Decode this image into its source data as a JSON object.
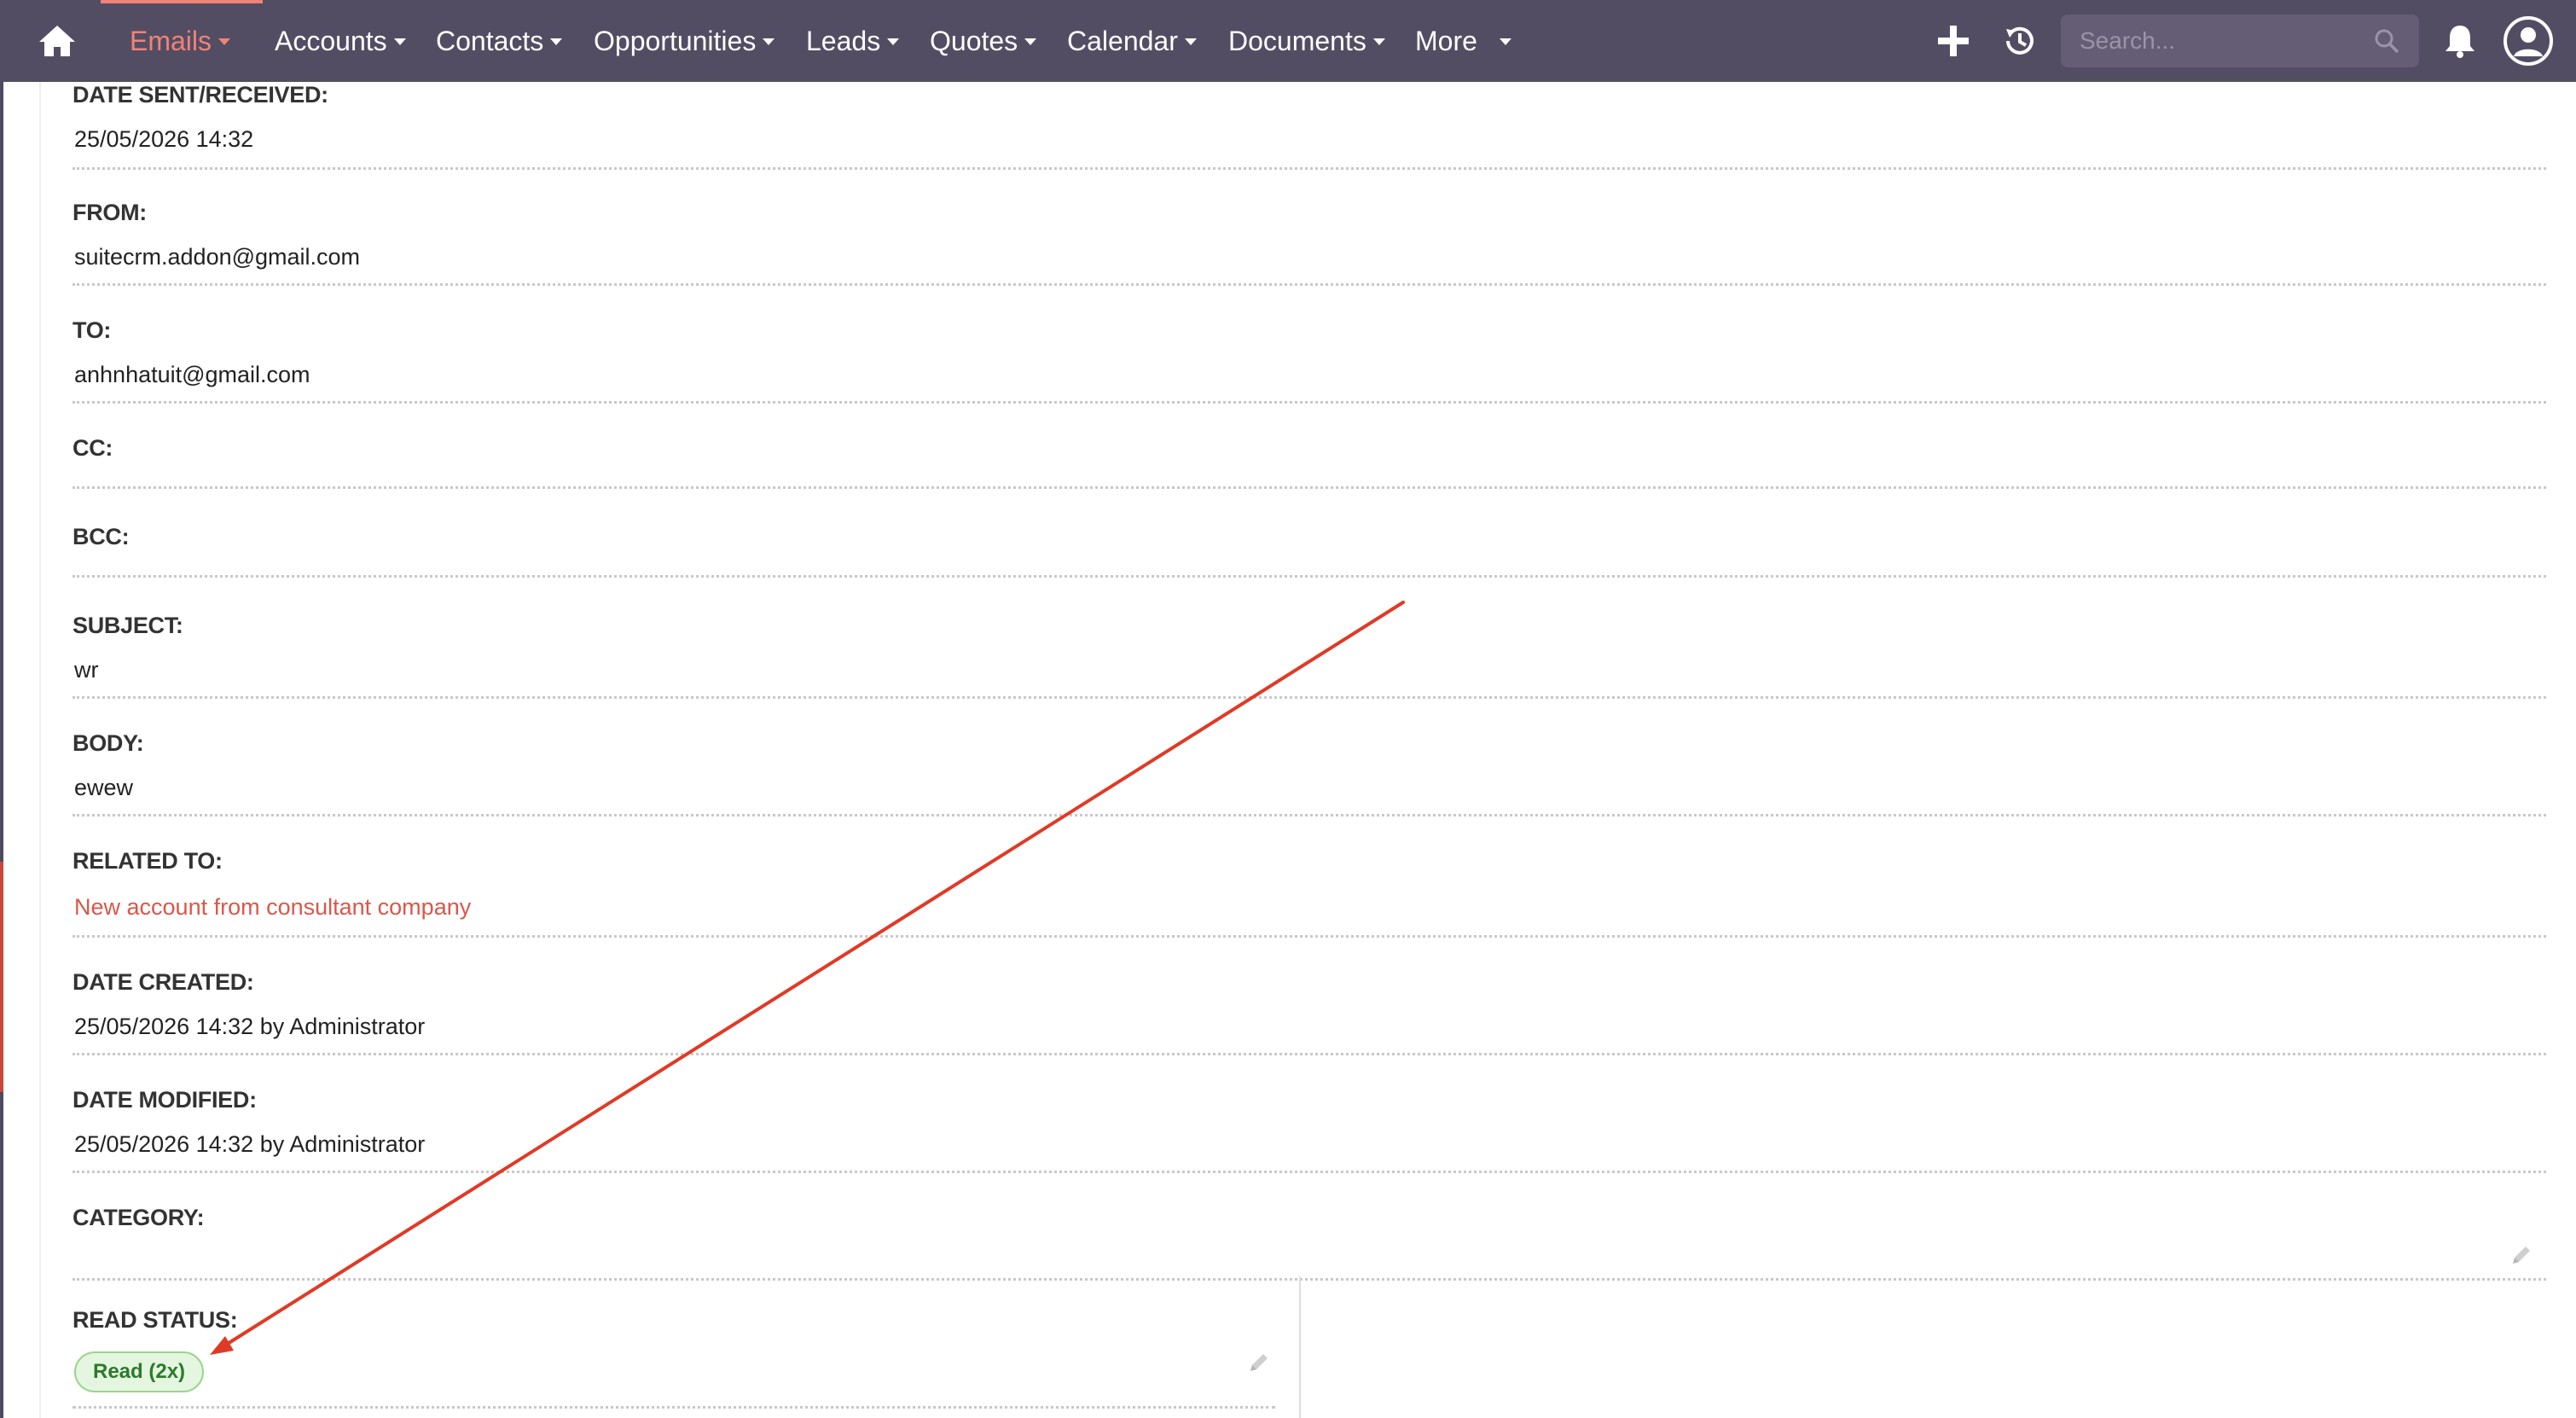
{
  "nav": {
    "items": [
      {
        "label": "Emails",
        "active": true
      },
      {
        "label": "Accounts"
      },
      {
        "label": "Contacts"
      },
      {
        "label": "Opportunities"
      },
      {
        "label": "Leads"
      },
      {
        "label": "Quotes"
      },
      {
        "label": "Calendar"
      },
      {
        "label": "Documents"
      },
      {
        "label": "More"
      }
    ],
    "search_placeholder": "Search...",
    "colors": {
      "bar": "#534d64",
      "active": "#f08377",
      "text": "#ffffff"
    },
    "icons": [
      "home-icon",
      "plus-icon",
      "history-icon",
      "search-icon",
      "bell-icon",
      "user-avatar-icon"
    ]
  },
  "email": {
    "fields": [
      {
        "label": "DATE SENT/RECEIVED:",
        "value": "25/05/2026 14:32"
      },
      {
        "label": "FROM:",
        "value": "suitecrm.addon@gmail.com"
      },
      {
        "label": "TO:",
        "value": "anhnhatuit@gmail.com"
      },
      {
        "label": "CC:",
        "value": ""
      },
      {
        "label": "BCC:",
        "value": ""
      },
      {
        "label": "SUBJECT:",
        "value": "wr"
      },
      {
        "label": "BODY:",
        "value": "ewew"
      },
      {
        "label": "RELATED TO:",
        "value": "New account from consultant company"
      },
      {
        "label": "DATE CREATED:",
        "value": "25/05/2026 14:32 by Administrator"
      },
      {
        "label": "DATE MODIFIED:",
        "value": "25/05/2026 14:32 by Administrator"
      },
      {
        "label": "CATEGORY:",
        "value": ""
      },
      {
        "label": "READ STATUS:",
        "value": "Read (2x)"
      }
    ],
    "link_color": "#d9574b",
    "read_badge_color": "#e4f6df"
  },
  "annotation": {
    "type": "arrow",
    "color": "#e03a26",
    "points_to": "read-status-badge"
  }
}
